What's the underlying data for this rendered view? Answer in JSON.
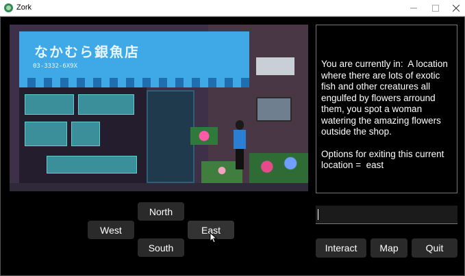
{
  "window": {
    "title": "Zork",
    "minimize_icon": "minimize-icon",
    "maximize_icon": "maximize-icon",
    "close_icon": "close-icon"
  },
  "scene": {
    "sign_text": "なかむら銀魚店",
    "sign_phone": "03-3332-6X9X"
  },
  "description": {
    "location_text": "You are currently in:  A location where there are lots of exotic fish and other creatures all engulfed by flowers arround them, you spot a woman watering the amazing flowers outside the shop.",
    "exits_text": "Options for exiting this current location =  east"
  },
  "command_input": {
    "value": "",
    "placeholder": ""
  },
  "navigation": {
    "north_label": "North",
    "west_label": "West",
    "east_label": "East",
    "south_label": "South"
  },
  "actions": {
    "interact_label": "Interact",
    "map_label": "Map",
    "quit_label": "Quit"
  },
  "colors": {
    "background": "#000000",
    "button_bg": "#2a2a2a",
    "text": "#ffffff",
    "awning": "#3fa9e8"
  }
}
